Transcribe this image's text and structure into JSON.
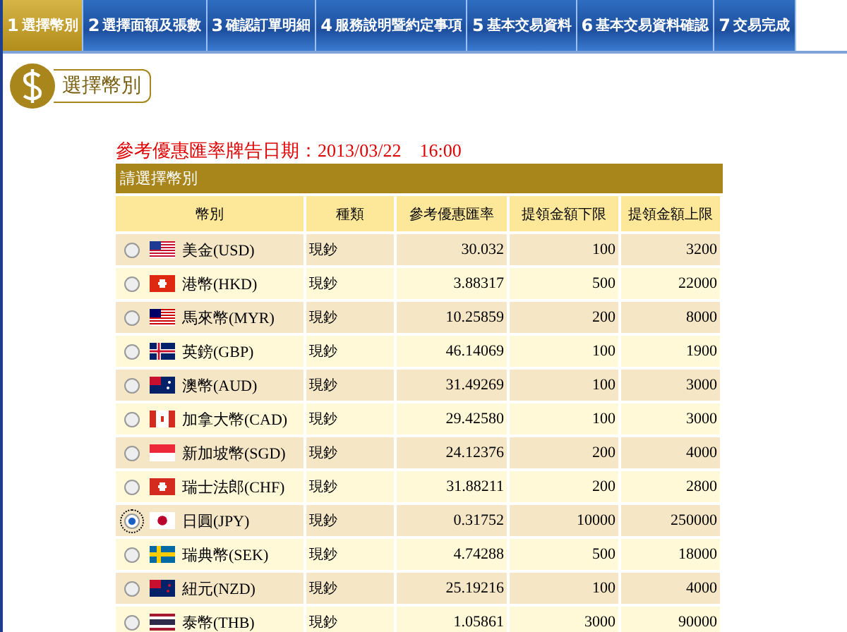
{
  "steps": [
    {
      "number": "1",
      "label": "選擇幣別",
      "selected": true
    },
    {
      "number": "2",
      "label": "選擇面額及張數",
      "selected": false
    },
    {
      "number": "3",
      "label": "確認訂單明細",
      "selected": false
    },
    {
      "number": "4",
      "label": "服務說明暨約定事項",
      "selected": false
    },
    {
      "number": "5",
      "label": "基本交易資料",
      "selected": false
    },
    {
      "number": "6",
      "label": "基本交易資料確認",
      "selected": false
    },
    {
      "number": "7",
      "label": "交易完成",
      "selected": false
    }
  ],
  "section_title": "選擇幣別",
  "notice": "參考優惠匯率牌告日期：2013/03/22　16:00",
  "table": {
    "caption": "請選擇幣別",
    "columns": [
      "幣別",
      "種類",
      "參考優惠匯率",
      "提領金額下限",
      "提領金額上限"
    ],
    "rows": [
      {
        "currency": "美金(USD)",
        "type": "現鈔",
        "rate": "30.032",
        "min": "100",
        "max": "3200",
        "selected": false
      },
      {
        "currency": "港幣(HKD)",
        "type": "現鈔",
        "rate": "3.88317",
        "min": "500",
        "max": "22000",
        "selected": false
      },
      {
        "currency": "馬來幣(MYR)",
        "type": "現鈔",
        "rate": "10.25859",
        "min": "200",
        "max": "8000",
        "selected": false
      },
      {
        "currency": "英鎊(GBP)",
        "type": "現鈔",
        "rate": "46.14069",
        "min": "100",
        "max": "1900",
        "selected": false
      },
      {
        "currency": "澳幣(AUD)",
        "type": "現鈔",
        "rate": "31.49269",
        "min": "100",
        "max": "3000",
        "selected": false
      },
      {
        "currency": "加拿大幣(CAD)",
        "type": "現鈔",
        "rate": "29.42580",
        "min": "100",
        "max": "3000",
        "selected": false
      },
      {
        "currency": "新加坡幣(SGD)",
        "type": "現鈔",
        "rate": "24.12376",
        "min": "200",
        "max": "4000",
        "selected": false
      },
      {
        "currency": "瑞士法郎(CHF)",
        "type": "現鈔",
        "rate": "31.88211",
        "min": "200",
        "max": "2800",
        "selected": false
      },
      {
        "currency": "日圓(JPY)",
        "type": "現鈔",
        "rate": "0.31752",
        "min": "10000",
        "max": "250000",
        "selected": true
      },
      {
        "currency": "瑞典幣(SEK)",
        "type": "現鈔",
        "rate": "4.74288",
        "min": "500",
        "max": "18000",
        "selected": false
      },
      {
        "currency": "紐元(NZD)",
        "type": "現鈔",
        "rate": "25.19216",
        "min": "100",
        "max": "4000",
        "selected": false
      },
      {
        "currency": "泰幣(THB)",
        "type": "現鈔",
        "rate": "1.05861",
        "min": "3000",
        "max": "90000",
        "selected": false
      }
    ]
  }
}
